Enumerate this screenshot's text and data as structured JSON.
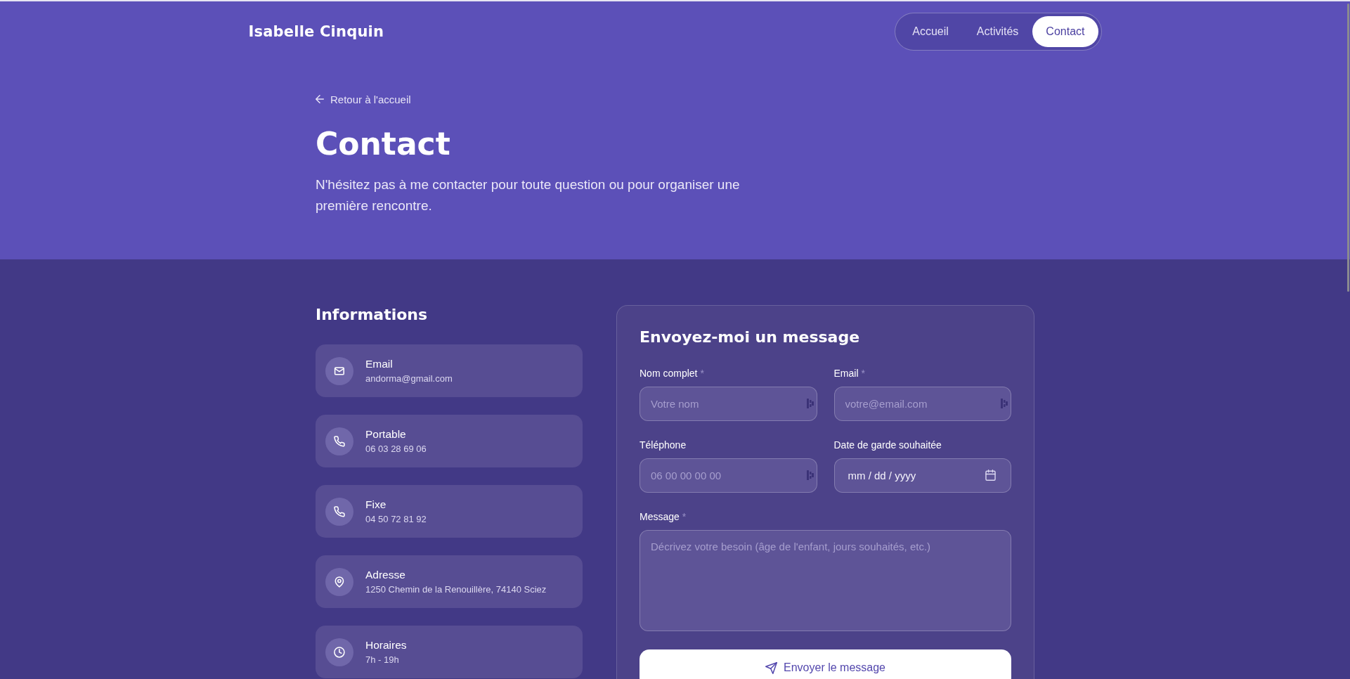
{
  "header": {
    "logo": "Isabelle Cinquin",
    "nav": [
      {
        "label": "Accueil",
        "selected": false
      },
      {
        "label": "Activités",
        "selected": false
      },
      {
        "label": "Contact",
        "selected": true
      }
    ]
  },
  "hero": {
    "back_link": "Retour à l'accueil",
    "title": "Contact",
    "subtitle": "N'hésitez pas à me contacter pour toute question ou pour organiser une première rencontre."
  },
  "info": {
    "title": "Informations",
    "items": [
      {
        "kind": "email",
        "label": "Email",
        "value": "andorma@gmail.com"
      },
      {
        "kind": "phone",
        "label": "Portable",
        "value": "06 03 28 69 06"
      },
      {
        "kind": "phone",
        "label": "Fixe",
        "value": "04 50 72 81 92"
      },
      {
        "kind": "address",
        "label": "Adresse",
        "value": "1250 Chemin de la Renouillère, 74140 Sciez"
      },
      {
        "kind": "hours",
        "label": "Horaires",
        "value": "7h - 19h"
      }
    ]
  },
  "form": {
    "title": "Envoyez-moi un message",
    "required_mark": "*",
    "fields": [
      {
        "kind": "text",
        "label": "Nom complet",
        "required": true,
        "placeholder": "Votre nom"
      },
      {
        "kind": "text",
        "label": "Email",
        "required": true,
        "placeholder": "votre@email.com"
      },
      {
        "kind": "text",
        "label": "Téléphone",
        "required": false,
        "placeholder": "06 00 00 00 00"
      },
      {
        "kind": "date",
        "label": "Date de garde souhaitée",
        "required": false,
        "placeholder": "mm / dd / yyyy"
      },
      {
        "kind": "textarea",
        "label": "Message",
        "required": true,
        "placeholder": "Décrivez votre besoin (âge de l'enfant, jours souhaités, etc.)"
      }
    ],
    "submit": "Envoyer le message"
  }
}
